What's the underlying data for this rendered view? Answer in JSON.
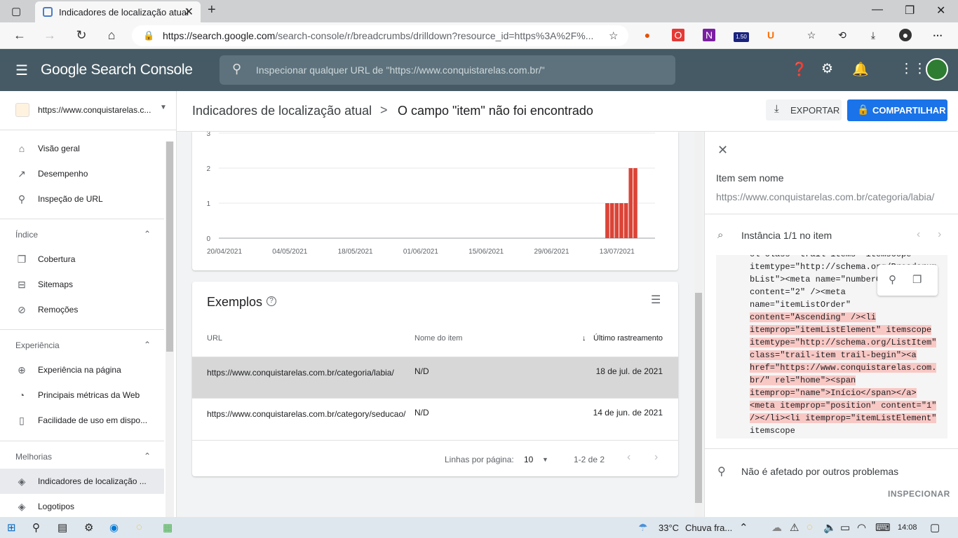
{
  "browser": {
    "tab_title": "Indicadores de localização atual",
    "url_domain": "https://search.google.com",
    "url_rest": "/search-console/r/breadcrumbs/drilldown?resource_id=https%3A%2F%...",
    "ext_badge": "1.50"
  },
  "header": {
    "brand": "Google Search Console",
    "search_placeholder": "Inspecionar qualquer URL de \"https://www.conquistarelas.com.br/\""
  },
  "sidebar": {
    "property": "https://www.conquistarelas.c...",
    "top_items": [
      {
        "label": "Visão geral",
        "icon": "home-icon"
      },
      {
        "label": "Desempenho",
        "icon": "trending-up-icon"
      },
      {
        "label": "Inspeção de URL",
        "icon": "search-icon"
      }
    ],
    "section_index": "Índice",
    "index_items": [
      {
        "label": "Cobertura",
        "icon": "file-copy-icon"
      },
      {
        "label": "Sitemaps",
        "icon": "sitemap-icon"
      },
      {
        "label": "Remoções",
        "icon": "visibility-off-icon"
      }
    ],
    "section_experience": "Experiência",
    "experience_items": [
      {
        "label": "Experiência na página",
        "icon": "plus-circle-icon"
      },
      {
        "label": "Principais métricas da Web",
        "icon": "speed-icon"
      },
      {
        "label": "Facilidade de uso em dispo...",
        "icon": "phone-icon"
      }
    ],
    "section_enhancements": "Melhorias",
    "enhancement_items": [
      {
        "label": "Indicadores de localização ...",
        "icon": "layers-icon"
      },
      {
        "label": "Logotipos",
        "icon": "layers-icon"
      }
    ]
  },
  "breadcrumb": {
    "parent": "Indicadores de localização atual",
    "separator": ">",
    "current": "O campo \"item\" não foi encontrado"
  },
  "actions": {
    "export": "EXPORTAR",
    "share": "COMPARTILHAR"
  },
  "chart_data": {
    "type": "bar",
    "y_ticks": [
      "3",
      "2",
      "1",
      "0"
    ],
    "ylim": [
      0,
      3
    ],
    "x_tick_labels": [
      "20/04/2021",
      "04/05/2021",
      "18/05/2021",
      "01/06/2021",
      "15/06/2021",
      "29/06/2021",
      "13/07/2021"
    ],
    "x": [
      "13/07/2021",
      "14/07/2021",
      "15/07/2021",
      "16/07/2021",
      "17/07/2021",
      "18/07/2021",
      "19/07/2021"
    ],
    "values": [
      1,
      1,
      1,
      1,
      1,
      2,
      2
    ],
    "bar_color": "#db4437",
    "grid": true
  },
  "examples": {
    "title": "Exemplos",
    "columns": {
      "url": "URL",
      "name": "Nome do item",
      "date": "Último rastreamento"
    },
    "rows": [
      {
        "url": "https://www.conquistarelas.com.br/categoria/labia/",
        "name": "N/D",
        "date": "18 de jul. de 2021"
      },
      {
        "url": "https://www.conquistarelas.com.br/category/seducao/",
        "name": "N/D",
        "date": "14 de jun. de 2021"
      }
    ],
    "rows_per_page_label": "Linhas por página:",
    "rows_per_page": "10",
    "range": "1-2 de 2"
  },
  "detail": {
    "item_name": "Item sem nome",
    "item_url": "https://www.conquistarelas.com.br/categoria/labia/",
    "instance": "Instância 1/1 no item",
    "not_affected": "Não é afetado por outros problemas",
    "inspect": "INSPECIONAR",
    "code_lines": [
      "ol class=\"trail-items\" itemscope",
      "itemtype=\"http://schema.org/Breadcrum",
      "bList\"><meta name=\"numberOf",
      "content=\"2\" /><meta",
      "name=\"itemListOrder\"",
      "content=\"Ascending\" /><li",
      "itemprop=\"itemListElement\" itemscope",
      "itemtype=\"http://schema.org/ListItem\"",
      "class=\"trail-item trail-begin\"><a",
      "href=\"https://www.conquistarelas.com.",
      "br/\" rel=\"home\"><span",
      "itemprop=\"name\">Início</span></a>",
      "<meta itemprop=\"position\" content=\"1\"",
      "/></li><li itemprop=\"itemListElement\"",
      "itemscope"
    ]
  },
  "taskbar": {
    "temp": "33°C",
    "weather": "Chuva fra...",
    "time": "14:08"
  }
}
